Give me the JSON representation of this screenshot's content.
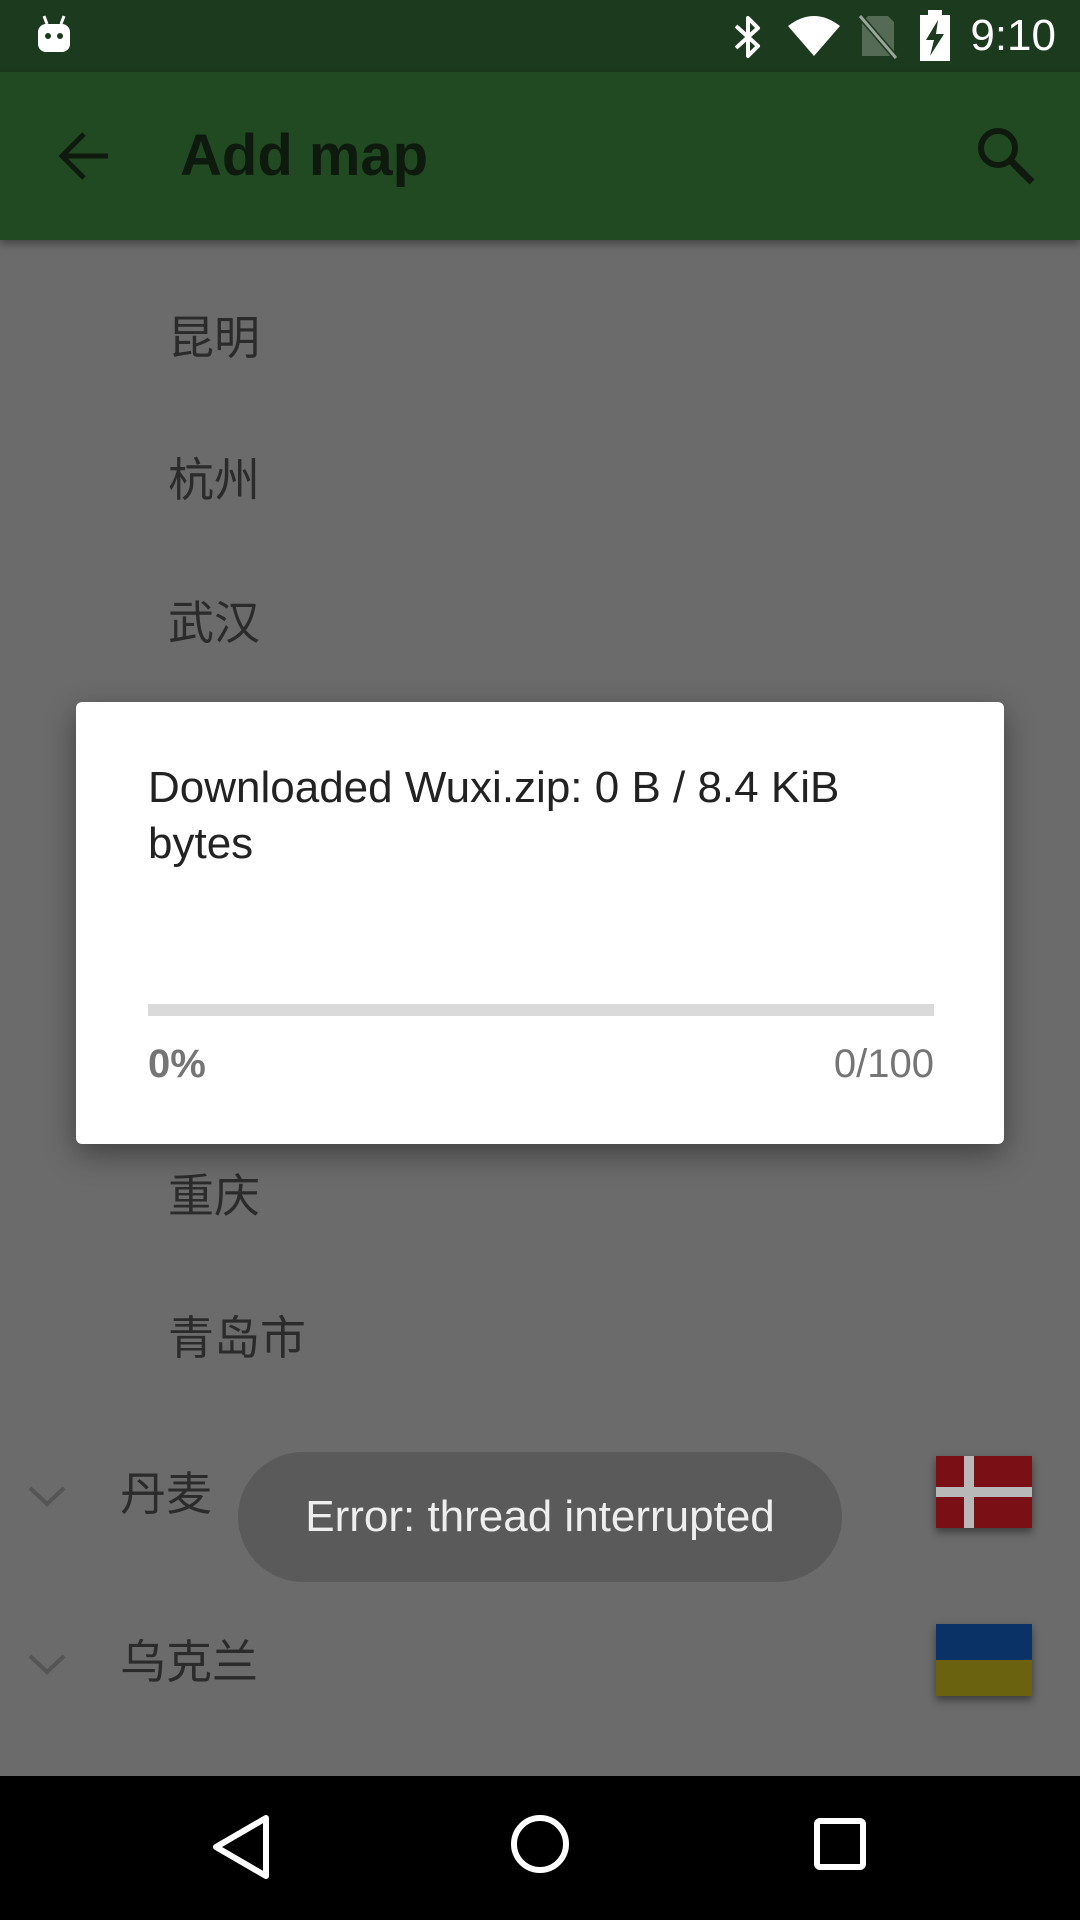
{
  "status_bar": {
    "time": "9:10",
    "icons": [
      "android-icon",
      "bluetooth-icon",
      "wifi-icon",
      "no-sim-icon",
      "battery-charging-icon"
    ]
  },
  "app_bar": {
    "title": "Add map",
    "back_icon": "arrow-left-icon",
    "search_icon": "search-icon"
  },
  "list": {
    "cities": [
      "昆明",
      "杭州",
      "武汉",
      "重庆",
      "青岛市"
    ],
    "countries": [
      {
        "label": "丹麦",
        "flag": "denmark-flag"
      },
      {
        "label": "乌克兰",
        "flag": "ukraine-flag"
      }
    ]
  },
  "dialog": {
    "message": "Downloaded Wuxi.zip: 0 B / 8.4 KiB bytes",
    "progress_fraction": 0,
    "progress_percent": "0%",
    "progress_count": "0/100"
  },
  "toast": {
    "text": "Error: thread interrupted"
  },
  "colors": {
    "status_bar": "#1c3a1e",
    "app_bar": "#214a22",
    "scrim_background": "#6b6b6b",
    "dialog": "#ffffff",
    "toast": "#5a5a5a",
    "nav_bar": "#000000"
  },
  "nav_bar": {
    "buttons": [
      "back-triangle-icon",
      "home-circle-icon",
      "recents-square-icon"
    ]
  }
}
